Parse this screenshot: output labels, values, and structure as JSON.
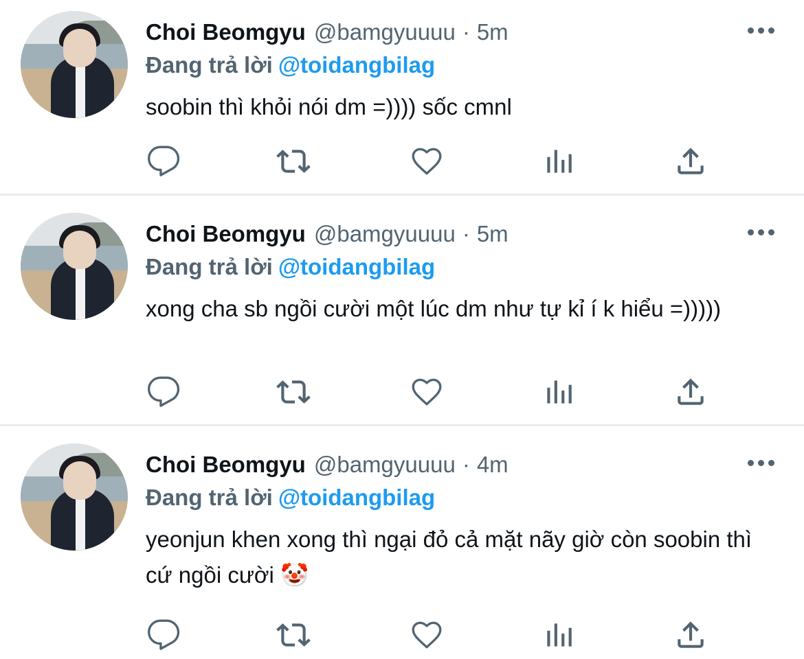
{
  "tweets": [
    {
      "author_name": "Choi Beomgyu",
      "handle": "@bamgyuuuu",
      "separator": "·",
      "time": "5m",
      "reply_label": "Đang trả lời",
      "reply_to": "@toidangbilag",
      "text": "soobin thì khỏi nói dm =)))) sốc cmnl"
    },
    {
      "author_name": "Choi Beomgyu",
      "handle": "@bamgyuuuu",
      "separator": "·",
      "time": "5m",
      "reply_label": "Đang trả lời",
      "reply_to": "@toidangbilag",
      "text": "xong cha sb ngồi cười một lúc dm như tự kỉ í k hiểu =)))))"
    },
    {
      "author_name": "Choi Beomgyu",
      "handle": "@bamgyuuuu",
      "separator": "·",
      "time": "4m",
      "reply_label": "Đang trả lời",
      "reply_to": "@toidangbilag",
      "text": "yeonjun khen xong thì ngại đỏ cả mặt nãy giờ còn soobin thì cứ ngồi cười 🤡"
    }
  ],
  "icons": {
    "more": "more-icon",
    "reply": "reply-icon",
    "retweet": "retweet-icon",
    "like": "heart-icon",
    "stats": "stats-icon",
    "share": "share-icon"
  },
  "colors": {
    "mention": "#1d9bf0",
    "secondary_text": "#536471",
    "divider": "#e6ecf0",
    "icon": "#536471"
  }
}
